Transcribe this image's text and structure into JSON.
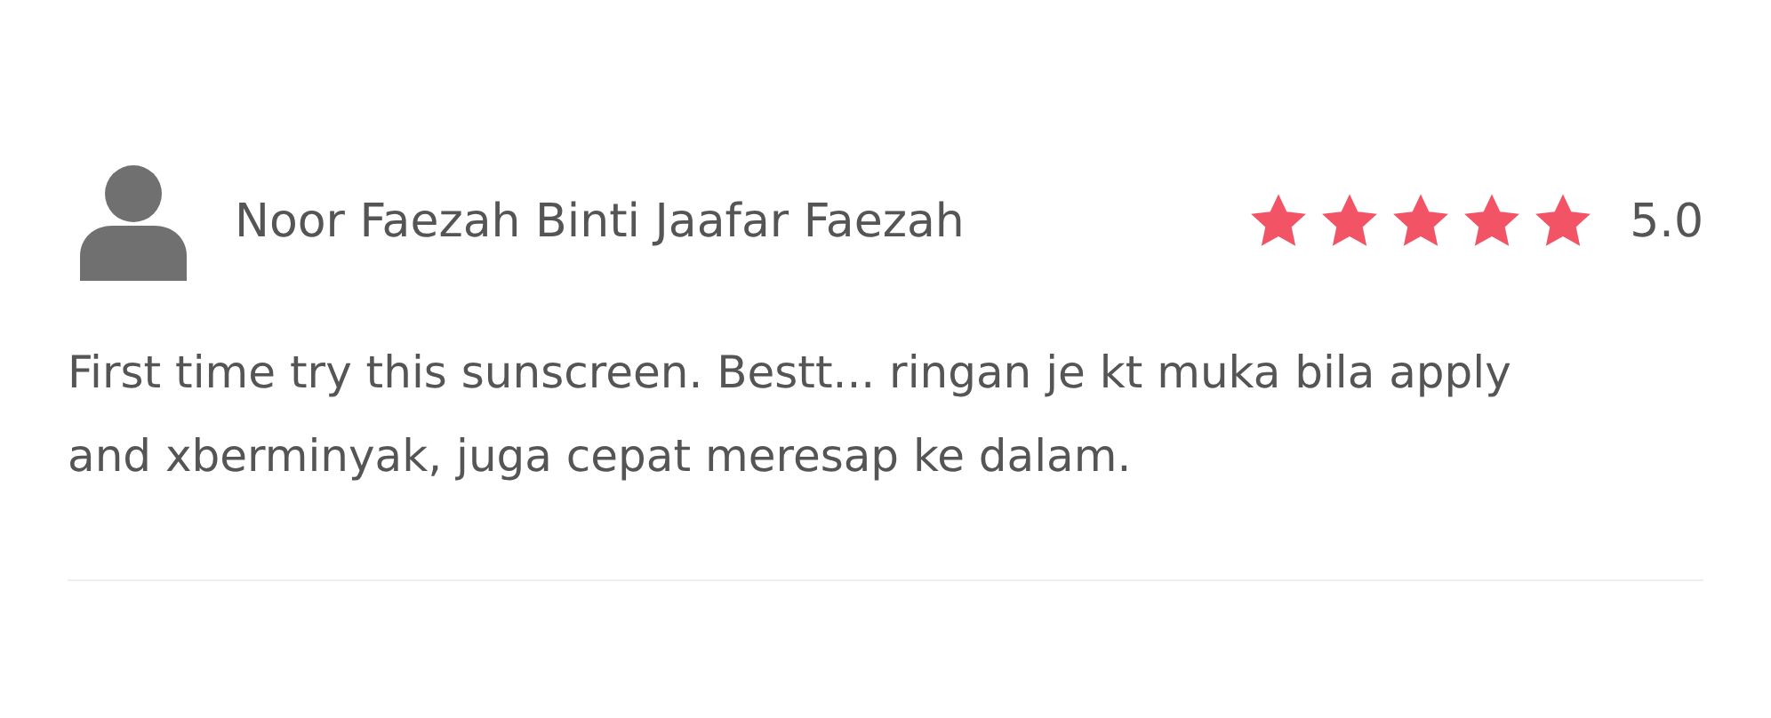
{
  "review": {
    "author": "Noor Faezah Binti Jaafar Faezah",
    "stars": 5,
    "rating": "5.0",
    "text": "First time try this sunscreen. Bestt... ringan je kt muka bila apply and xberminyak, juga cepat meresap ke dalam."
  }
}
